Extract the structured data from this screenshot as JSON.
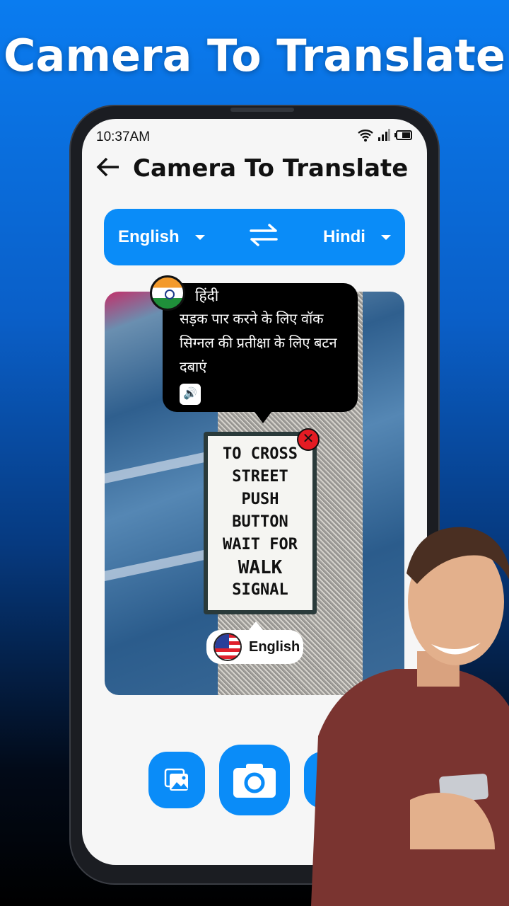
{
  "headline": "Camera To Translate",
  "status": {
    "time": "10:37AM",
    "icons": [
      "wifi-icon",
      "signal-icon",
      "battery-icon"
    ]
  },
  "appbar": {
    "title": "Camera To Translate",
    "back_icon": "arrow-left-icon"
  },
  "language_bar": {
    "source": "English",
    "target": "Hindi",
    "swap_icon": "swap-arrows-icon",
    "color": "#0a8cf8"
  },
  "translation": {
    "language_label": "हिंदी",
    "text": "सड़क पार करने के लिए वॉक सिग्नल की प्रतीक्षा के लिए बटन दबाएं",
    "speaker_icon": "speaker-icon"
  },
  "source_pill": {
    "label": "English"
  },
  "sign_lines": [
    "TO CROSS",
    "STREET",
    "←——",
    "PUSH",
    "BUTTON",
    "WAIT FOR",
    "WALK",
    "SIGNAL"
  ],
  "bottom_buttons": [
    "gallery-icon",
    "camera-icon",
    "text-icon"
  ]
}
